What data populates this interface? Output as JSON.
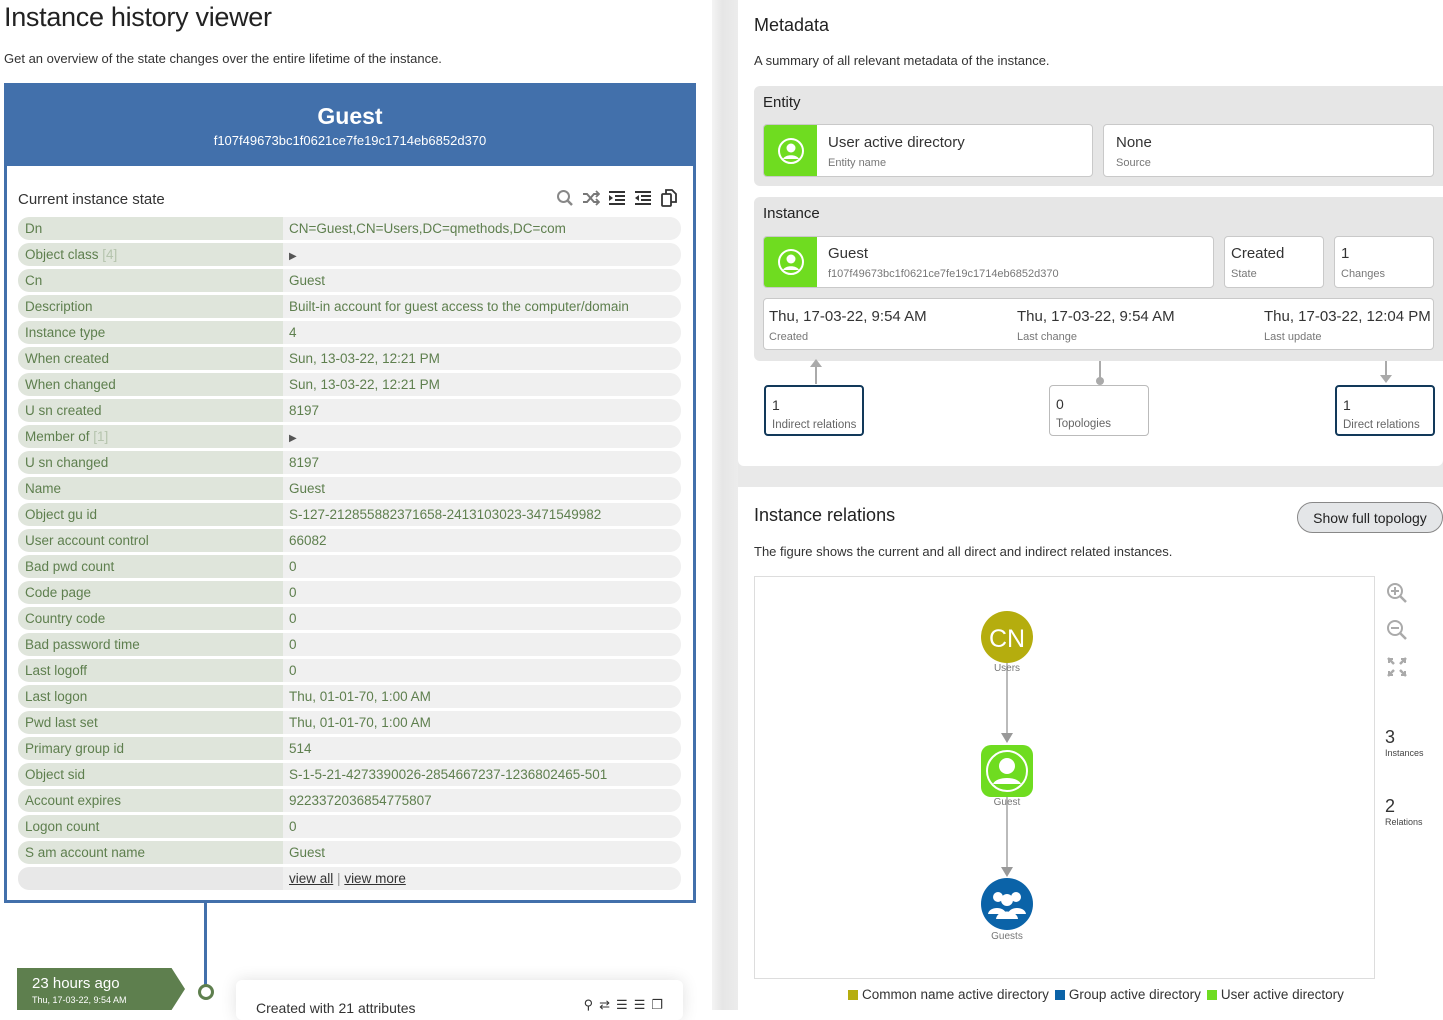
{
  "page": {
    "title": "Instance history viewer",
    "subtitle": "Get an overview of the state changes over the entire lifetime of the instance."
  },
  "instance_card": {
    "name": "Guest",
    "id": "f107f49673bc1f0621ce7fe19c1714eb6852d370",
    "state_title": "Current instance state",
    "toolbar": [
      "search-icon",
      "shuffle-icon",
      "indent-icon",
      "outdent-icon",
      "copy-icon"
    ],
    "rows": [
      {
        "key": "Dn",
        "value": "CN=Guest,CN=Users,DC=qmethods,DC=com"
      },
      {
        "key": "Object class",
        "count": "[4]",
        "value": "",
        "expandable": true
      },
      {
        "key": "Cn",
        "value": "Guest"
      },
      {
        "key": "Description",
        "value": "Built-in account for guest access to the computer/domain"
      },
      {
        "key": "Instance type",
        "value": "4"
      },
      {
        "key": "When created",
        "value": "Sun, 13-03-22, 12:21 PM"
      },
      {
        "key": "When changed",
        "value": "Sun, 13-03-22, 12:21 PM"
      },
      {
        "key": "U sn created",
        "value": "8197"
      },
      {
        "key": "Member of",
        "count": "[1]",
        "value": "",
        "expandable": true
      },
      {
        "key": "U sn changed",
        "value": "8197"
      },
      {
        "key": "Name",
        "value": "Guest"
      },
      {
        "key": "Object gu id",
        "value": "S-127-212855882371658-2413103023-3471549982"
      },
      {
        "key": "User account control",
        "value": "66082"
      },
      {
        "key": "Bad pwd count",
        "value": "0"
      },
      {
        "key": "Code page",
        "value": "0"
      },
      {
        "key": "Country code",
        "value": "0"
      },
      {
        "key": "Bad password time",
        "value": "0"
      },
      {
        "key": "Last logoff",
        "value": "0"
      },
      {
        "key": "Last logon",
        "value": "Thu, 01-01-70, 1:00 AM"
      },
      {
        "key": "Pwd last set",
        "value": "Thu, 01-01-70, 1:00 AM"
      },
      {
        "key": "Primary group id",
        "value": "514"
      },
      {
        "key": "Object sid",
        "value": "S-1-5-21-4273390026-2854667237-1236802465-501"
      },
      {
        "key": "Account expires",
        "value": "9223372036854775807"
      },
      {
        "key": "Logon count",
        "value": "0"
      },
      {
        "key": "S am account name",
        "value": "Guest"
      }
    ],
    "footer": {
      "view_all": "view all",
      "separator": "|",
      "view_more": "view more"
    }
  },
  "timeline": {
    "ago": "23 hours ago",
    "date": "Thu, 17-03-22, 9:54 AM",
    "change_text": "Created with 21 attributes"
  },
  "metadata": {
    "title": "Metadata",
    "desc": "A summary of all relevant metadata of the instance.",
    "entity": {
      "label": "Entity",
      "name": "User active directory",
      "name_label": "Entity name",
      "source": "None",
      "source_label": "Source"
    },
    "instance": {
      "label": "Instance",
      "name": "Guest",
      "id": "f107f49673bc1f0621ce7fe19c1714eb6852d370",
      "state": "Created",
      "state_label": "State",
      "changes": "1",
      "changes_label": "Changes",
      "created": "Thu, 17-03-22, 9:54 AM",
      "created_label": "Created",
      "last_change": "Thu, 17-03-22, 9:54 AM",
      "last_change_label": "Last change",
      "last_update": "Thu, 17-03-22, 12:04 PM",
      "last_update_label": "Last update"
    },
    "relations": {
      "indirect": "1",
      "indirect_label": "Indirect relations",
      "topologies": "0",
      "topologies_label": "Topologies",
      "direct": "1",
      "direct_label": "Direct relations"
    }
  },
  "relations_panel": {
    "title": "Instance relations",
    "desc": "The figure shows the current and all direct and indirect related instances.",
    "button": "Show full topology",
    "nodes": [
      {
        "label": "Users",
        "glyph": "CN",
        "type": "Common name active directory"
      },
      {
        "label": "Guest",
        "glyph": "user-icon",
        "type": "User active directory"
      },
      {
        "label": "Guests",
        "glyph": "group-icon",
        "type": "Group active directory"
      }
    ],
    "stats": {
      "instances": "3",
      "instances_label": "Instances",
      "relations": "2",
      "relations_label": "Relations"
    },
    "legend": [
      {
        "label": "Common name active directory",
        "color": "#b5ad0e"
      },
      {
        "label": "Group active directory",
        "color": "#0b63a8"
      },
      {
        "label": "User active directory",
        "color": "#6fdc20"
      }
    ]
  },
  "colors": {
    "header_blue": "#4270ab",
    "label_green": "#5e7f4e",
    "user_green": "#6fdc20",
    "cn_olive": "#b5ad0e",
    "group_blue": "#0b63a8"
  }
}
